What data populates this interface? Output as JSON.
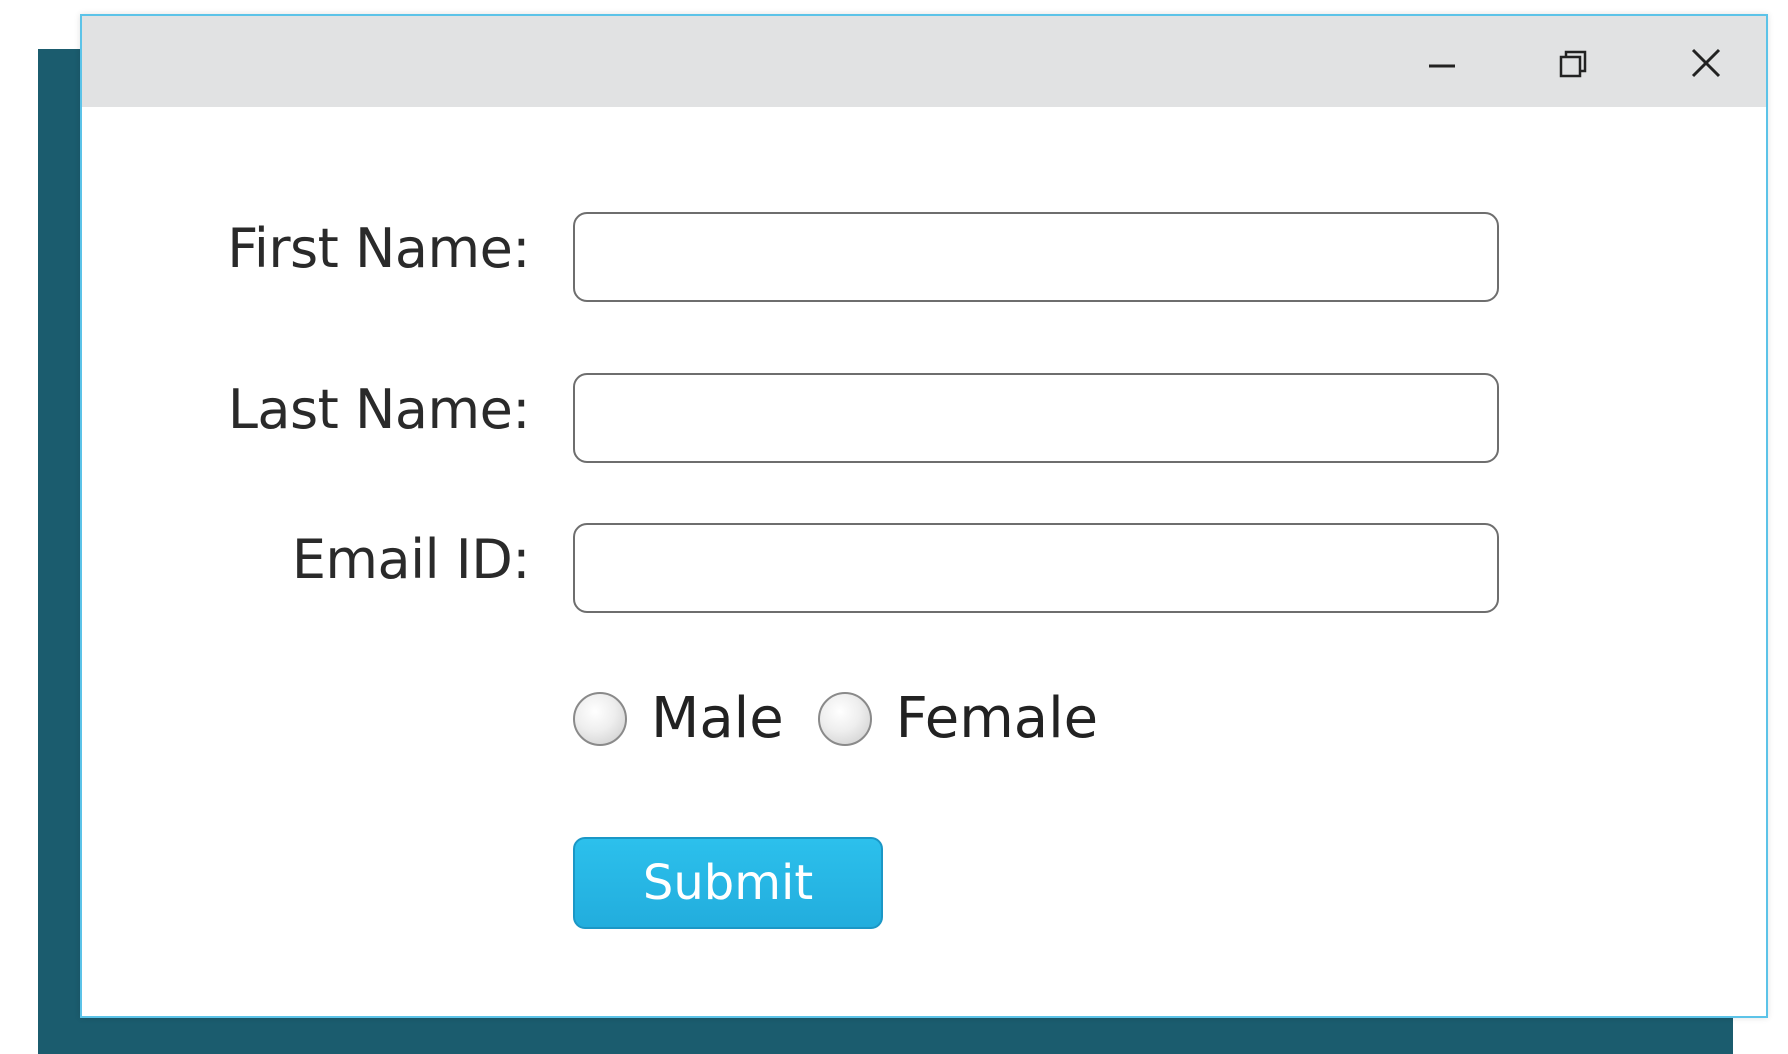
{
  "window": {
    "controls": {
      "minimize_icon": "minimize-icon",
      "maximize_icon": "restore-icon",
      "close_icon": "close-icon"
    }
  },
  "form": {
    "first_name_label": "First Name:",
    "last_name_label": "Last Name:",
    "email_label": "Email ID:",
    "first_name_value": "",
    "last_name_value": "",
    "email_value": "",
    "gender_options": [
      "Male",
      "Female"
    ],
    "submit_label": "Submit"
  },
  "colors": {
    "accent": "#22addd",
    "frame": "#1b5c6e",
    "titlebar": "#e1e2e3",
    "window_border": "#5cc3e8"
  }
}
